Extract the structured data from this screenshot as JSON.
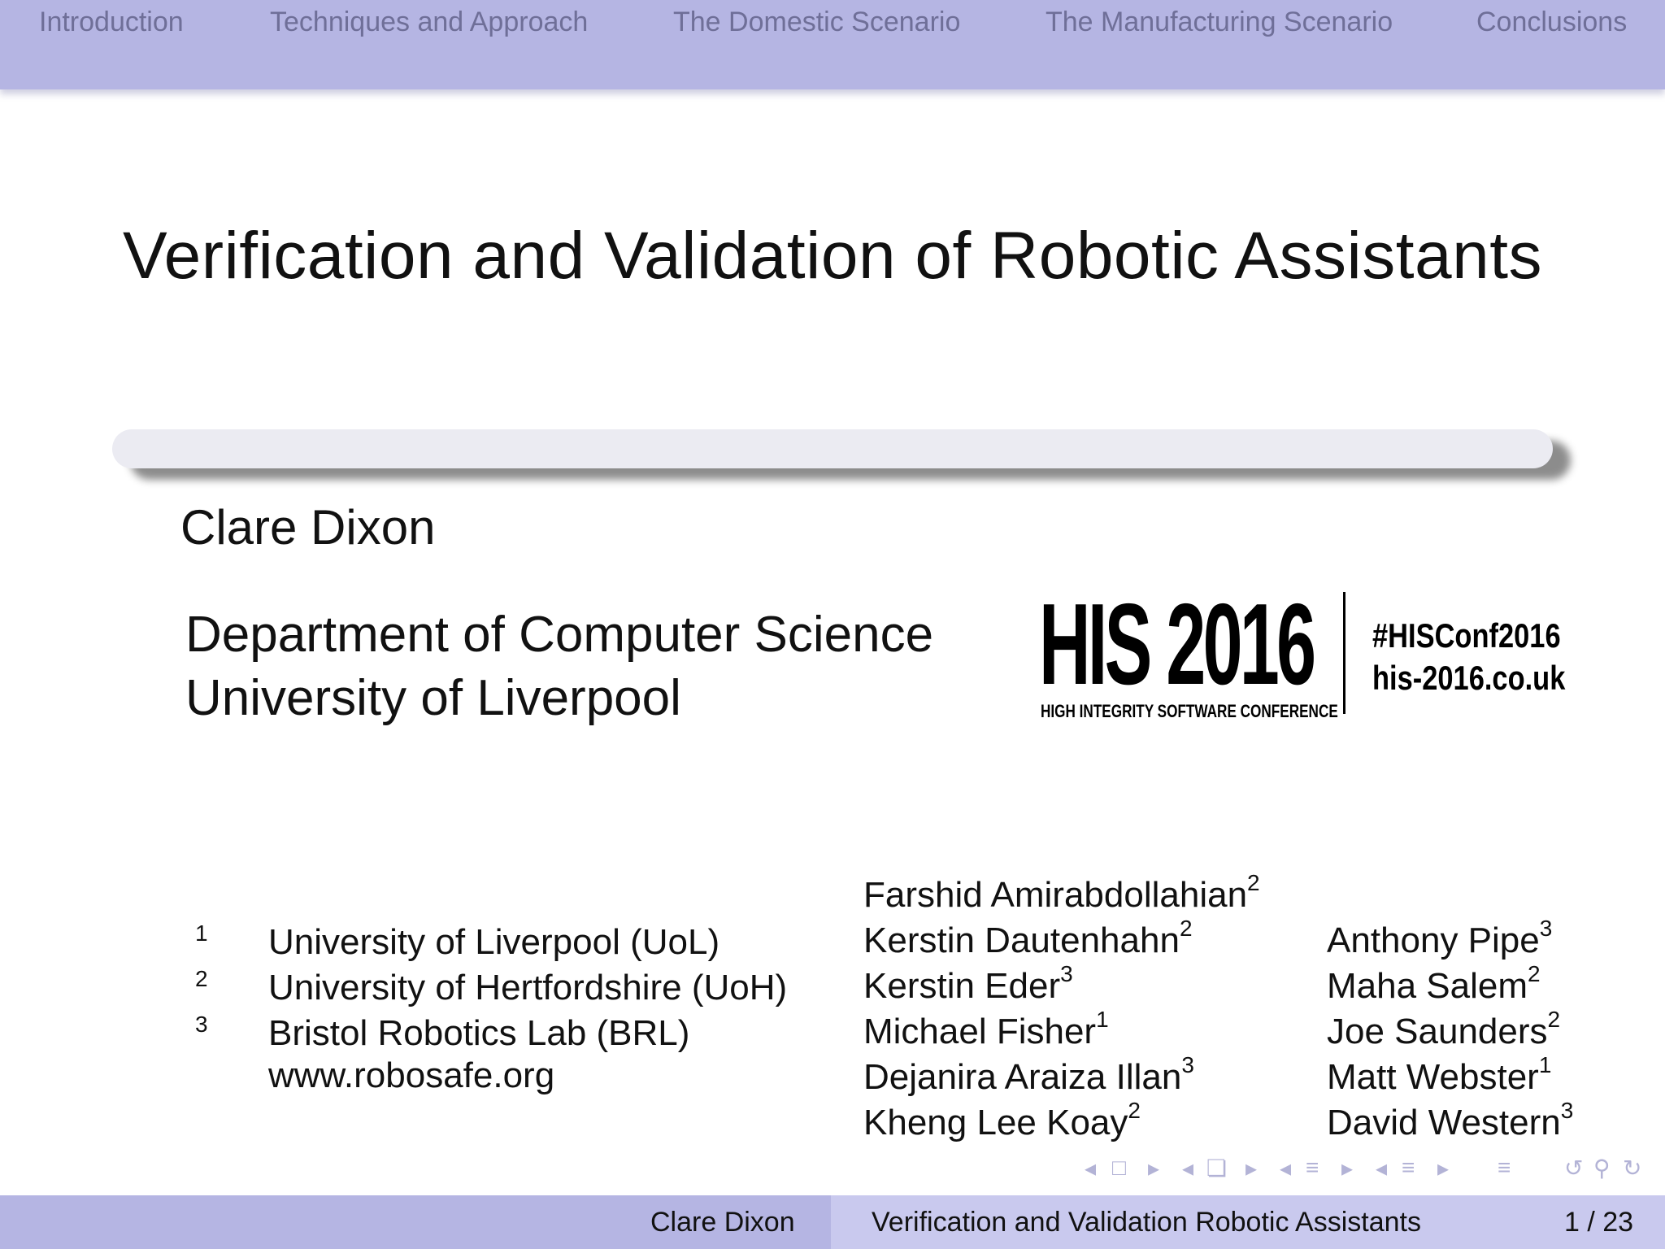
{
  "nav": {
    "sections": [
      "Introduction",
      "Techniques and Approach",
      "The Domestic Scenario",
      "The Manufacturing Scenario",
      "Conclusions"
    ]
  },
  "title": "Verification and Validation of Robotic Assistants",
  "author": "Clare Dixon",
  "department": {
    "line1": "Department of Computer Science",
    "line2": "University of Liverpool"
  },
  "logo": {
    "main": "HIS 2016",
    "sub": "HIGH INTEGRITY SOFTWARE CONFERENCE",
    "hashtag": "#HISConf2016",
    "site": "his-2016.co.uk"
  },
  "affiliations": [
    {
      "num": "1",
      "name": "University of Liverpool (UoL)"
    },
    {
      "num": "2",
      "name": "University of Hertfordshire (UoH)"
    },
    {
      "num": "3",
      "name": "Bristol Robotics Lab (BRL)"
    }
  ],
  "website": "www.robosafe.org",
  "collaborators_col1": [
    {
      "name": "Farshid Amirabdollahian",
      "sup": "2"
    },
    {
      "name": "Kerstin Dautenhahn",
      "sup": "2"
    },
    {
      "name": "Kerstin Eder",
      "sup": "3"
    },
    {
      "name": "Michael Fisher",
      "sup": "1"
    },
    {
      "name": "Dejanira Araiza Illan",
      "sup": "3"
    },
    {
      "name": "Kheng Lee Koay",
      "sup": "2"
    }
  ],
  "collaborators_col2": [
    {
      "name": "Anthony Pipe",
      "sup": "3"
    },
    {
      "name": "Maha Salem",
      "sup": "2"
    },
    {
      "name": "Joe Saunders",
      "sup": "2"
    },
    {
      "name": "Matt Webster",
      "sup": "1"
    },
    {
      "name": "David Western",
      "sup": "3"
    }
  ],
  "footer": {
    "author": "Clare Dixon",
    "short_title": "Verification and Validation Robotic Assistants",
    "page": "1 / 23"
  },
  "beamer_nav": {
    "icons": [
      "frame-back-icon",
      "frame-icon",
      "frame-forward-icon",
      "subsection-back-icon",
      "subsection-icon",
      "subsection-forward-icon",
      "section-back-icon",
      "section-icon",
      "section-forward-icon",
      "subsection-list-back-icon",
      "subsection-list-icon",
      "subsection-list-forward-icon",
      "align-icon",
      "undo-icon",
      "search-icon",
      "redo-icon"
    ]
  },
  "colors": {
    "header": "#b5b5e3",
    "footer_left": "#b5b5e3",
    "footer_right": "#c9c9ee",
    "nav_text": "#6f6f98"
  }
}
